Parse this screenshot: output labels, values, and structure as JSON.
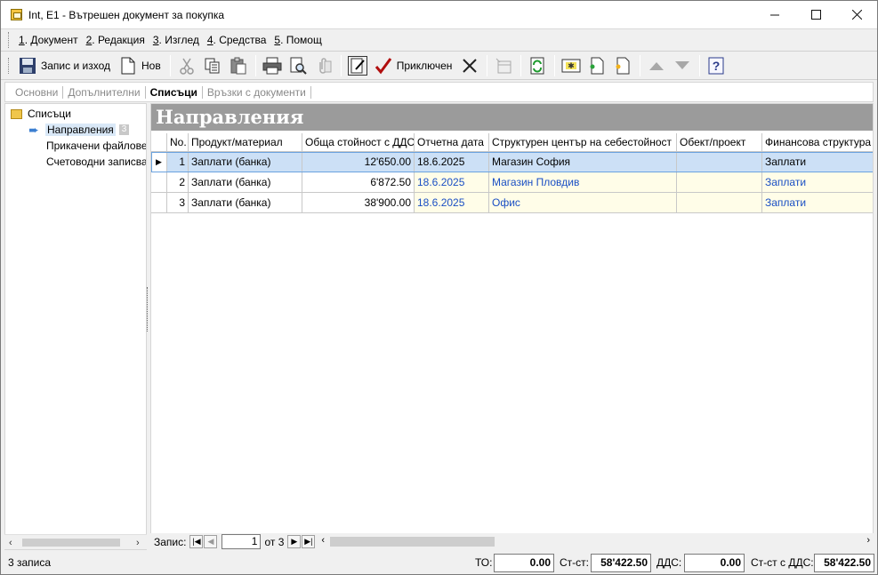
{
  "window": {
    "title": "Int, E1 - Вътрешен документ за покупка"
  },
  "menu": [
    {
      "key": "1",
      "label": ". Документ"
    },
    {
      "key": "2",
      "label": ". Редакция"
    },
    {
      "key": "3",
      "label": ". Изглед"
    },
    {
      "key": "4",
      "label": ". Средства"
    },
    {
      "key": "5",
      "label": ". Помощ"
    }
  ],
  "toolbar": {
    "save_exit": "Запис и изход",
    "new": "Нов",
    "finish": "Приключен"
  },
  "tabs": [
    "Основни",
    "Допълнителни",
    "Списъци",
    "Връзки с документи"
  ],
  "tree": {
    "root": "Списъци",
    "items": [
      {
        "label": "Направления",
        "count": "3"
      },
      {
        "label": "Прикачени файлове"
      },
      {
        "label": "Счетоводни записва"
      }
    ]
  },
  "banner": "Направления",
  "grid": {
    "columns": [
      "No.",
      "Продукт/материал",
      "Обща стойност с ДДС",
      "Отчетна дата",
      "Структурен център на себестойност",
      "Обект/проект",
      "Финансова структура"
    ],
    "rows": [
      {
        "no": "1",
        "product": "Заплати (банка)",
        "total": "12'650.00",
        "date": "18.6.2025",
        "center": "Магазин София",
        "object": "",
        "fin": "Заплати"
      },
      {
        "no": "2",
        "product": "Заплати (банка)",
        "total": "6'872.50",
        "date": "18.6.2025",
        "center": "Магазин Пловдив",
        "object": "",
        "fin": "Заплати"
      },
      {
        "no": "3",
        "product": "Заплати (банка)",
        "total": "38'900.00",
        "date": "18.6.2025",
        "center": "Офис",
        "object": "",
        "fin": "Заплати"
      }
    ]
  },
  "nav": {
    "label": "Запис:",
    "current": "1",
    "of": "от 3"
  },
  "status": {
    "records": "3 записа",
    "to_label": "ТО:",
    "to_value": "0.00",
    "st_label": "Ст-ст:",
    "st_value": "58'422.50",
    "vat_label": "ДДС:",
    "vat_value": "0.00",
    "stvat_label": "Ст-ст с ДДС:",
    "stvat_value": "58'422.50"
  },
  "colors": {
    "banner": "#9b9b9b",
    "selection": "#cce0f6",
    "link_blue": "#1a4fc4",
    "alt_row": "#fffde8"
  }
}
